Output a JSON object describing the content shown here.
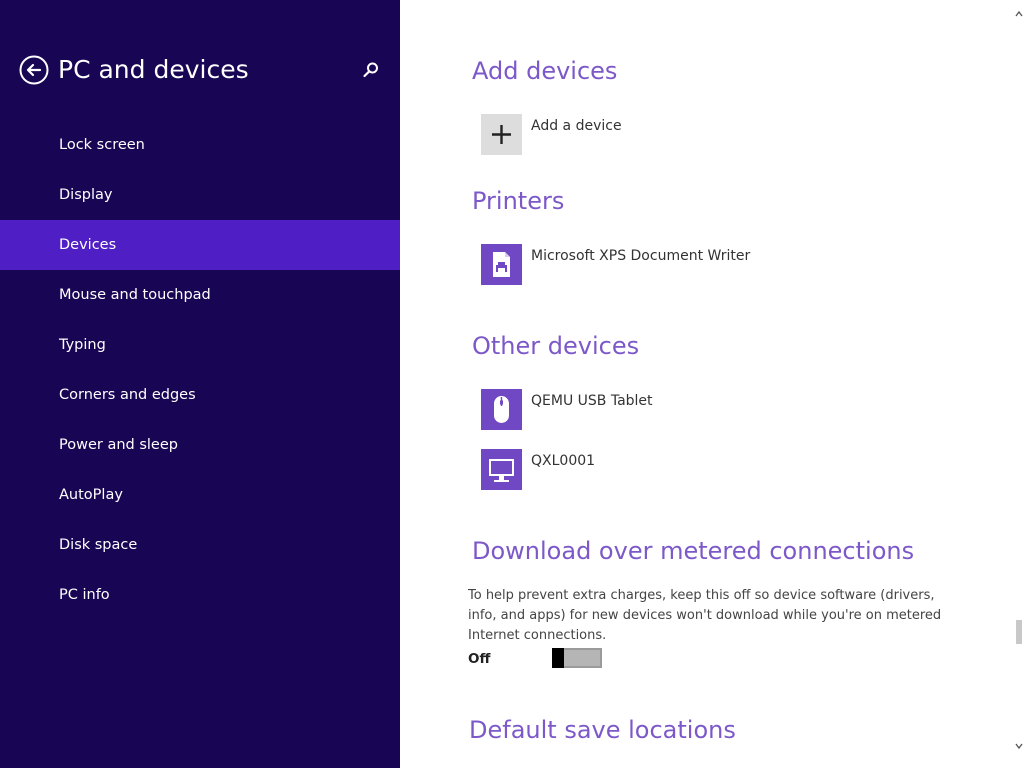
{
  "sidebar": {
    "title": "PC and devices",
    "back_icon": "back-arrow-circle-icon",
    "search_icon": "search-icon",
    "items": [
      {
        "label": "Lock screen"
      },
      {
        "label": "Display"
      },
      {
        "label": "Devices",
        "selected": true
      },
      {
        "label": "Mouse and touchpad"
      },
      {
        "label": "Typing"
      },
      {
        "label": "Corners and edges"
      },
      {
        "label": "Power and sleep"
      },
      {
        "label": "AutoPlay"
      },
      {
        "label": "Disk space"
      },
      {
        "label": "PC info"
      }
    ]
  },
  "content": {
    "add_devices": {
      "title": "Add devices",
      "add_label": "Add a device"
    },
    "printers": {
      "title": "Printers",
      "items": [
        {
          "label": "Microsoft XPS Document Writer",
          "icon": "printer-icon"
        }
      ]
    },
    "other_devices": {
      "title": "Other devices",
      "items": [
        {
          "label": "QEMU USB Tablet",
          "icon": "mouse-icon"
        },
        {
          "label": "QXL0001",
          "icon": "monitor-icon"
        }
      ]
    },
    "metered": {
      "title": "Download over metered connections",
      "description": "To help prevent extra charges, keep this off so device software (drivers, info, and apps) for new devices won't download while you're on metered Internet connections.",
      "toggle_state": "Off"
    },
    "save_locations": {
      "title": "Default save locations"
    }
  },
  "colors": {
    "sidebar_bg": "#180553",
    "selected_bg": "#4f1ec4",
    "accent": "#7c58c9",
    "tile": "#7048c4"
  }
}
